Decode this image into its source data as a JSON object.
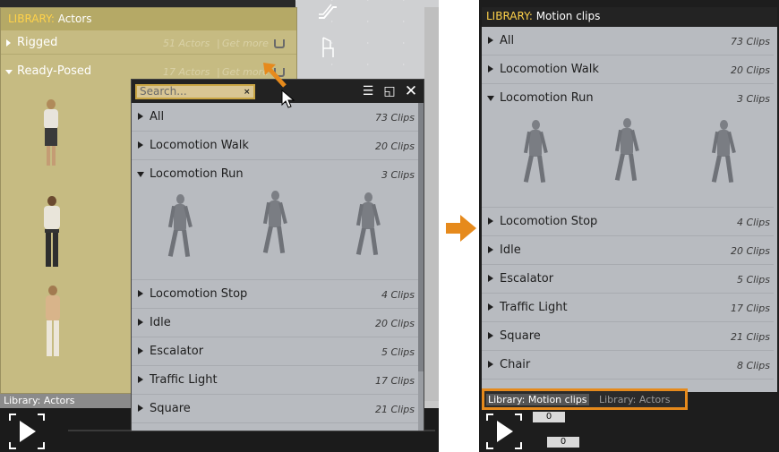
{
  "left": {
    "actors_library": {
      "header_key": "LIBRARY:",
      "header_title": "Actors",
      "rows": [
        {
          "label": "Rigged",
          "count": "51 Actors",
          "link": "Get more"
        },
        {
          "label": "Ready-Posed",
          "count": "17 Actors",
          "link": "Get more"
        }
      ],
      "tab_label": "Library: Actors"
    },
    "popup": {
      "search_placeholder": "Search...",
      "search_clear": "×",
      "items": [
        {
          "label": "All",
          "count": "73 Clips",
          "expanded": false
        },
        {
          "label": "Locomotion Walk",
          "count": "20 Clips",
          "expanded": false
        },
        {
          "label": "Locomotion Run",
          "count": "3 Clips",
          "expanded": true
        },
        {
          "label": "Locomotion Stop",
          "count": "4 Clips",
          "expanded": false
        },
        {
          "label": "Idle",
          "count": "20 Clips",
          "expanded": false
        },
        {
          "label": "Escalator",
          "count": "5 Clips",
          "expanded": false
        },
        {
          "label": "Traffic Light",
          "count": "17 Clips",
          "expanded": false
        },
        {
          "label": "Square",
          "count": "21 Clips",
          "expanded": false
        }
      ]
    }
  },
  "right": {
    "header_key": "LIBRARY:",
    "header_title": "Motion clips",
    "items": [
      {
        "label": "All",
        "count": "73 Clips",
        "expanded": false
      },
      {
        "label": "Locomotion Walk",
        "count": "20 Clips",
        "expanded": false
      },
      {
        "label": "Locomotion Run",
        "count": "3 Clips",
        "expanded": true
      },
      {
        "label": "Locomotion Stop",
        "count": "4 Clips",
        "expanded": false
      },
      {
        "label": "Idle",
        "count": "20 Clips",
        "expanded": false
      },
      {
        "label": "Escalator",
        "count": "5 Clips",
        "expanded": false
      },
      {
        "label": "Traffic Light",
        "count": "17 Clips",
        "expanded": false
      },
      {
        "label": "Square",
        "count": "21 Clips",
        "expanded": false
      },
      {
        "label": "Chair",
        "count": "8 Clips",
        "expanded": false
      }
    ],
    "tabs": [
      {
        "label": "Library: Motion clips",
        "active": true
      },
      {
        "label": "Library: Actors",
        "active": false
      }
    ],
    "counter_top": "0",
    "counter_bottom": "0"
  },
  "colors": {
    "accent": "#e68a1c",
    "header_key": "#ffd24a"
  }
}
